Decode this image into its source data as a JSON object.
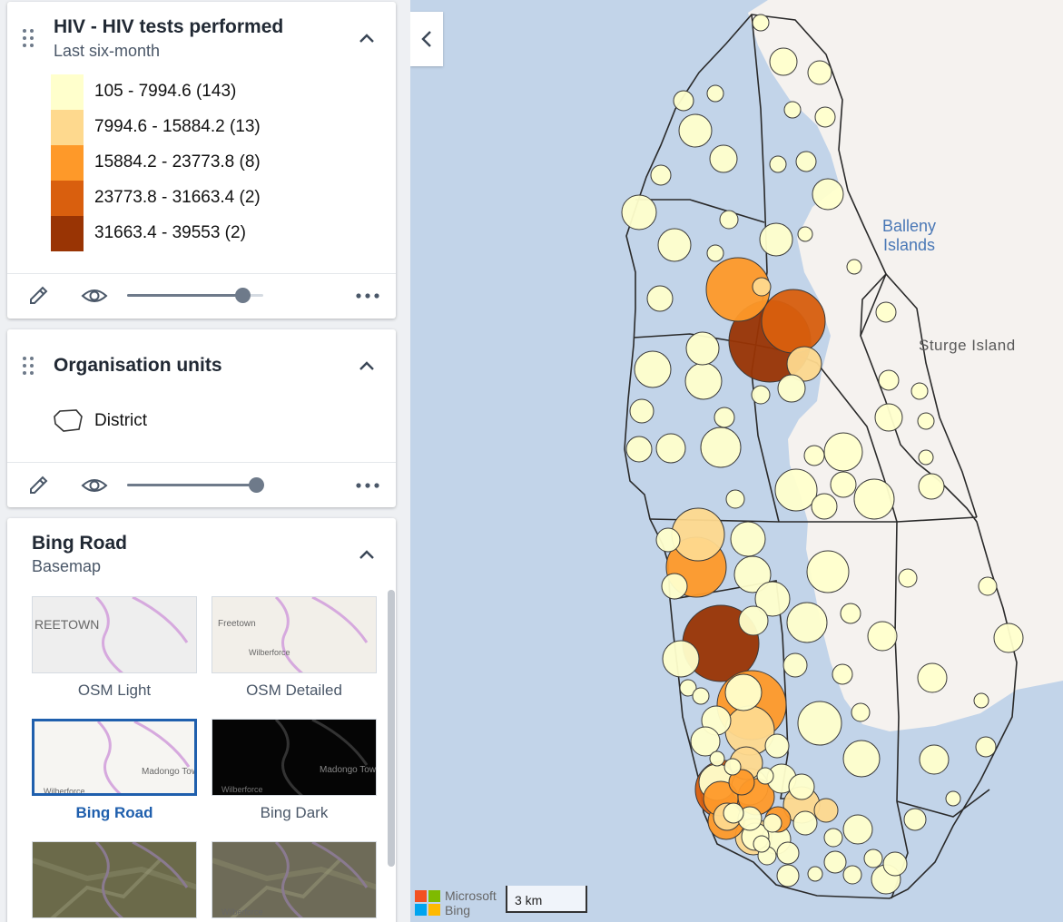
{
  "thematic_layer": {
    "title": "HIV - HIV tests performed",
    "subtitle": "Last six-month",
    "legend": [
      {
        "label": "105 - 7994.6 (143)",
        "color": "#ffffcc"
      },
      {
        "label": "7994.6 - 15884.2 (13)",
        "color": "#fed98e"
      },
      {
        "label": "15884.2 - 23773.8 (8)",
        "color": "#fe9929"
      },
      {
        "label": "23773.8 - 31663.4 (2)",
        "color": "#d95f0e"
      },
      {
        "label": "31663.4 - 39553 (2)",
        "color": "#993404"
      }
    ],
    "opacity": 0.85,
    "icons": [
      "drag-handle-icon",
      "chevron-up-icon",
      "edit-icon",
      "visibility-icon",
      "more-options-icon"
    ]
  },
  "org_units_layer": {
    "title": "Organisation units",
    "legend_item": "District",
    "opacity": 0.95
  },
  "basemap": {
    "title": "Bing Road",
    "subtitle": "Basemap",
    "options": [
      {
        "label": "OSM Light",
        "thumb_text": "REETOWN",
        "thumb_bg": "#eeeeee",
        "selected": false
      },
      {
        "label": "OSM Detailed",
        "thumb_text": "Freetown",
        "thumb_text2": "Wilberforce",
        "thumb_bg": "#f2efe9",
        "selected": false
      },
      {
        "label": "Bing Road",
        "thumb_text": "Madongo Town",
        "thumb_text2": "Wilberforce",
        "thumb_bg": "#f6f5f2",
        "selected": true
      },
      {
        "label": "Bing Dark",
        "thumb_text": "Madongo Town",
        "thumb_text2": "Wilberforce",
        "thumb_bg": "#050505",
        "selected": false
      },
      {
        "label": "",
        "thumb_bg": "#6b6a4a",
        "selected": false
      },
      {
        "label": "",
        "thumb_text2": "Wilberforce",
        "thumb_bg": "#6e6b58",
        "selected": false
      }
    ]
  },
  "map": {
    "labels": {
      "balleny": "Balleny\nIslands",
      "sturge": "Sturge Island"
    },
    "attribution": {
      "microsoft": "Microsoft",
      "bing": "Bing"
    },
    "scale": "3 km",
    "colors": {
      "water": "#c2d4e9",
      "land": "#f5f2ef",
      "boundary": "#2a2a2a"
    }
  }
}
